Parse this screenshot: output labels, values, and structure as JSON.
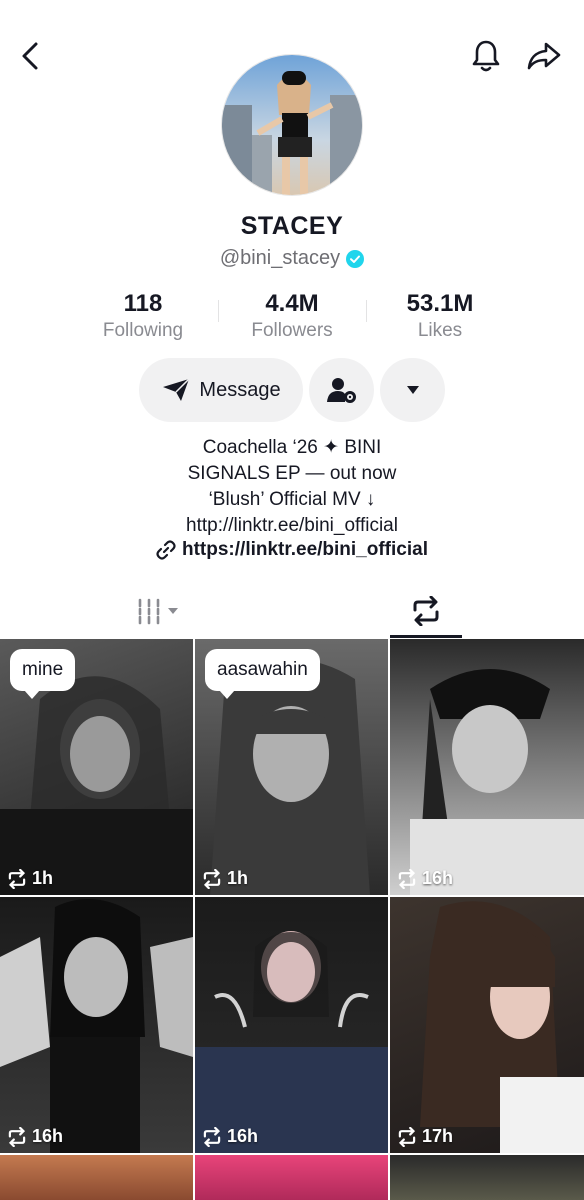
{
  "header": {
    "back_icon": "chevron-left-icon",
    "bell_icon": "bell-icon",
    "share_icon": "share-arrow-icon"
  },
  "profile": {
    "name": "STACEY",
    "handle": "@bini_stacey",
    "verified": true
  },
  "stats": [
    {
      "value": "118",
      "label": "Following"
    },
    {
      "value": "4.4M",
      "label": "Followers"
    },
    {
      "value": "53.1M",
      "label": "Likes"
    }
  ],
  "actions": {
    "message_label": "Message",
    "message_icon": "paper-plane-icon",
    "settings_icon": "person-gear-icon",
    "more_icon": "caret-down-icon"
  },
  "bio": {
    "lines": [
      "Coachella ‘26 ✦ BINI",
      "SIGNALS EP — out now",
      "‘Blush’ Official MV ↓",
      "http://linktr.ee/bini_official"
    ],
    "link": "https://linktr.ee/bini_official"
  },
  "tabs": {
    "grid_icon": "video-grid-icon",
    "repost_icon": "repost-icon"
  },
  "videos": [
    {
      "label": "mine",
      "time": "1h"
    },
    {
      "label": "aasawahin",
      "time": "1h"
    },
    {
      "label": "",
      "time": "16h"
    },
    {
      "label": "",
      "time": "16h"
    },
    {
      "label": "",
      "time": "16h"
    },
    {
      "label": "",
      "time": "17h"
    }
  ],
  "colors": {
    "verified": "#20d5ec",
    "button_bg": "#f1f1f2",
    "text": "#161823",
    "secondary_text": "#8a8b91"
  }
}
